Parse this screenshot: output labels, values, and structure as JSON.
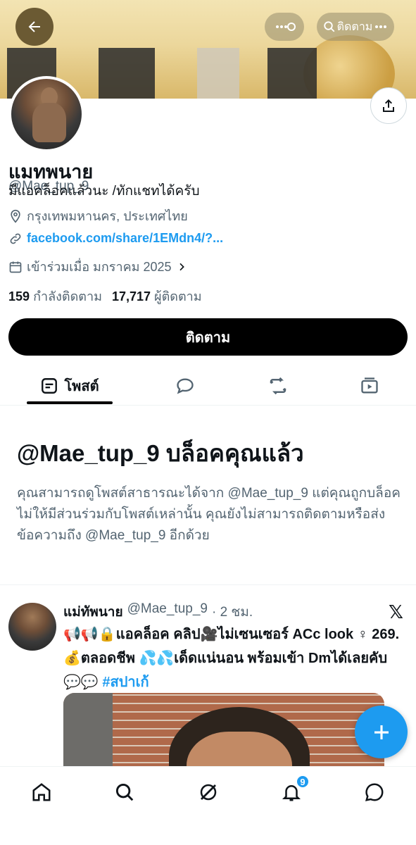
{
  "profile": {
    "display_name": "แมทพนาย",
    "handle": "@Mae_tup_9",
    "bio": "มีแอคล็อคแล้วนะ /ทักแชทได้ครับ",
    "location": "กรุงเทพมหานคร, ประเทศไทย",
    "link": "facebook.com/share/1EMdn4/?...",
    "joined": "เข้าร่วมเมื่อ มกราคม 2025",
    "following_count": "159",
    "following_label": "กำลังติดตาม",
    "followers_count": "17,717",
    "followers_label": "ผู้ติดตาม"
  },
  "header": {
    "search_label": "ติดตาม"
  },
  "follow_button": "ติดตาม",
  "tabs": {
    "posts_label": "โพสต์"
  },
  "blocked": {
    "title": "@Mae_tup_9 บล็อคคุณแล้ว",
    "message": "คุณสามารถดูโพสต์สาธารณะได้จาก @Mae_tup_9 แต่คุณถูกบล็อคไม่ให้มีส่วนร่วมกับโพสต์เหล่านั้น คุณยังไม่สามารถติดตามหรือส่งข้อความถึง @Mae_tup_9 อีกด้วย"
  },
  "post": {
    "author": "แม่ทัพนาย",
    "handle": "@Mae_tup_9",
    "time": "· 2 ชม.",
    "text": "📢📢🔒แอคล็อค  คลิป🎥ไม่เซนเซอร์ ACc look ♀  269.💰ตลอดชีพ 💦💦เด็ดแน่นอน พร้อมเข้า Dmได้เลยคับ 💬💬",
    "hashtag": "#สปาเก้"
  },
  "nav": {
    "notifications_badge": "9"
  },
  "colors": {
    "accent": "#1d9bf0",
    "text": "#0f1419",
    "muted": "#536471"
  }
}
